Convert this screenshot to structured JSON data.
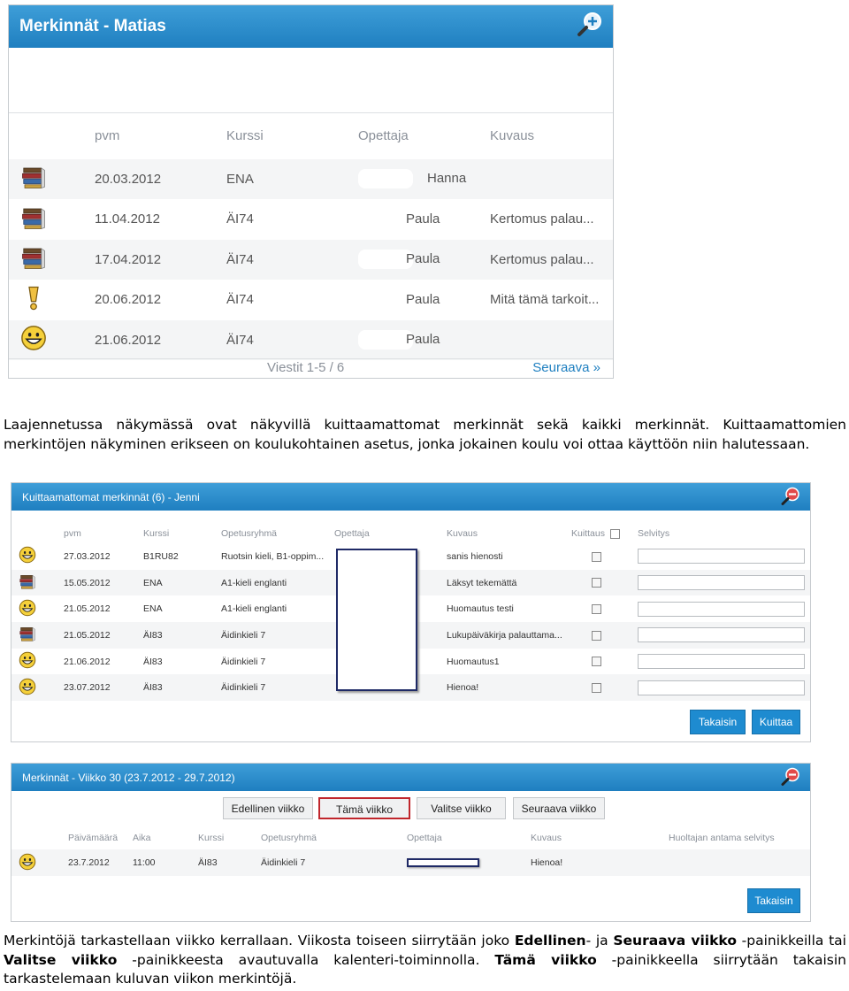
{
  "panel1": {
    "title": "Merkinnät - Matias",
    "headers": [
      "pvm",
      "Kurssi",
      "Opettaja",
      "Kuvaus"
    ],
    "rows": [
      {
        "icon": "book-stack-icon",
        "date": "20.03.2012",
        "course": "ENA",
        "teacher": "Hanna",
        "desc": ""
      },
      {
        "icon": "book-stack-icon",
        "date": "11.04.2012",
        "course": "ÄI74",
        "teacher": "Paula",
        "desc": "Kertomus palau..."
      },
      {
        "icon": "book-stack-icon",
        "date": "17.04.2012",
        "course": "ÄI74",
        "teacher": "Paula",
        "desc": "Kertomus palau..."
      },
      {
        "icon": "exclamation-icon",
        "date": "20.06.2012",
        "course": "ÄI74",
        "teacher": "Paula",
        "desc": "Mitä tämä tarkoit..."
      },
      {
        "icon": "smiley-icon",
        "date": "21.06.2012",
        "course": "ÄI74",
        "teacher": "Paula",
        "desc": ""
      }
    ],
    "pager": "Viestit 1-5 / 6",
    "next": "Seuraava »"
  },
  "para1": "Laajennetussa näkymässä ovat näkyvillä kuittaamattomat merkinnät sekä kaikki merkinnät. Kuittaamattomien merkintöjen näkyminen erikseen on koulukohtainen asetus, jonka jokainen koulu voi ottaa käyttöön niin halutessaan.",
  "panel2": {
    "title": "Kuittaamattomat merkinnät (6) - Jenni",
    "headers": [
      "pvm",
      "Kurssi",
      "Opetusryhmä",
      "Opettaja",
      "Kuvaus",
      "Kuittaus",
      "Selvitys"
    ],
    "rows": [
      {
        "icon": "smiley-icon",
        "date": "27.03.2012",
        "course": "B1RU82",
        "group": "Ruotsin kieli, B1-oppim...",
        "desc": "sanis hienosti"
      },
      {
        "icon": "book-stack-icon",
        "date": "15.05.2012",
        "course": "ENA",
        "group": "A1-kieli englanti",
        "desc": "Läksyt tekemättä"
      },
      {
        "icon": "smiley-icon",
        "date": "21.05.2012",
        "course": "ENA",
        "group": "A1-kieli englanti",
        "desc": "Huomautus testi"
      },
      {
        "icon": "book-stack-icon",
        "date": "21.05.2012",
        "course": "ÄI83",
        "group": "Äidinkieli 7",
        "desc": "Lukupäiväkirja palauttama..."
      },
      {
        "icon": "smiley-icon",
        "date": "21.06.2012",
        "course": "ÄI83",
        "group": "Äidinkieli 7",
        "desc": "Huomautus1"
      },
      {
        "icon": "smiley-icon",
        "date": "23.07.2012",
        "course": "ÄI83",
        "group": "Äidinkieli 7",
        "desc": "Hienoa!"
      }
    ],
    "back": "Takaisin",
    "ack": "Kuittaa"
  },
  "panel3": {
    "title": "Merkinnät - Viikko 30 (23.7.2012 - 29.7.2012)",
    "week_buttons": [
      "Edellinen viikko",
      "Tämä viikko",
      "Valitse viikko",
      "Seuraava viikko"
    ],
    "headers": [
      "Päivämäärä",
      "Aika",
      "Kurssi",
      "Opetusryhmä",
      "Opettaja",
      "Kuvaus",
      "Huoltajan antama selvitys"
    ],
    "rows": [
      {
        "icon": "smiley-icon",
        "date": "23.7.2012",
        "time": "11:00",
        "course": "ÄI83",
        "group": "Äidinkieli 7",
        "desc": "Hienoa!"
      }
    ],
    "back": "Takaisin"
  },
  "para2": {
    "t1": "Merkintöjä tarkastellaan viikko kerrallaan. Viikosta toiseen siirrytään joko ",
    "b1": "Edellinen",
    "t2": "- ja ",
    "b2": "Seuraava viikko",
    "t3": " -painikkeilla tai ",
    "b3": "Valitse viikko",
    "t4": " -painikkeesta avautuvalla kalenteri-toiminnolla. ",
    "b4": "Tämä viikko",
    "t5": " -painikkeella siirrytään takaisin tarkastelemaan kuluvan viikon merkintöjä."
  },
  "colors": {
    "header_blue": "#2a8ccc",
    "row_alt": "#f4f5f6",
    "highlight_red": "#c0262c"
  }
}
